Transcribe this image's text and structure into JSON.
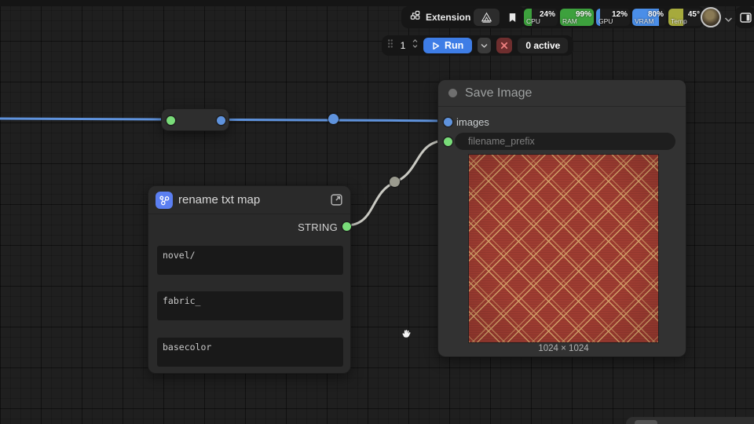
{
  "topbar": {
    "extensions_label": "Extensions",
    "meters": [
      {
        "label": "CPU",
        "value": "24%",
        "pct": 24,
        "color": "#3da13d"
      },
      {
        "label": "RAM",
        "value": "99%",
        "pct": 99,
        "color": "#3da13d"
      },
      {
        "label": "GPU",
        "value": "12%",
        "pct": 12,
        "color": "#4a8ee8"
      },
      {
        "label": "VRAM",
        "value": "80%",
        "pct": 80,
        "color": "#4a8ee8"
      },
      {
        "label": "Temp",
        "value": "45°",
        "pct": 45,
        "color": "#a6aa3c"
      }
    ]
  },
  "runbar": {
    "queue_count": "1",
    "run_label": "Run",
    "active_label": "0 active"
  },
  "save_image_node": {
    "title": "Save Image",
    "input_images_label": "images",
    "filename_prefix_label": "filename_prefix",
    "image_size_label": "1024 × 1024"
  },
  "rename_node": {
    "title": "rename txt map",
    "output_label": "STRING",
    "fields": [
      "novel/",
      "fabric_",
      "basecolor"
    ]
  },
  "colors": {
    "accent_blue": "#3e7de6",
    "wire_blue": "#5f93dd",
    "wire_gray": "#c9c9c2",
    "slot_green": "#79dc79",
    "slot_blue": "#5f93dd",
    "fabric_red": "#9e3c31",
    "fabric_gold": "#d2a068"
  }
}
